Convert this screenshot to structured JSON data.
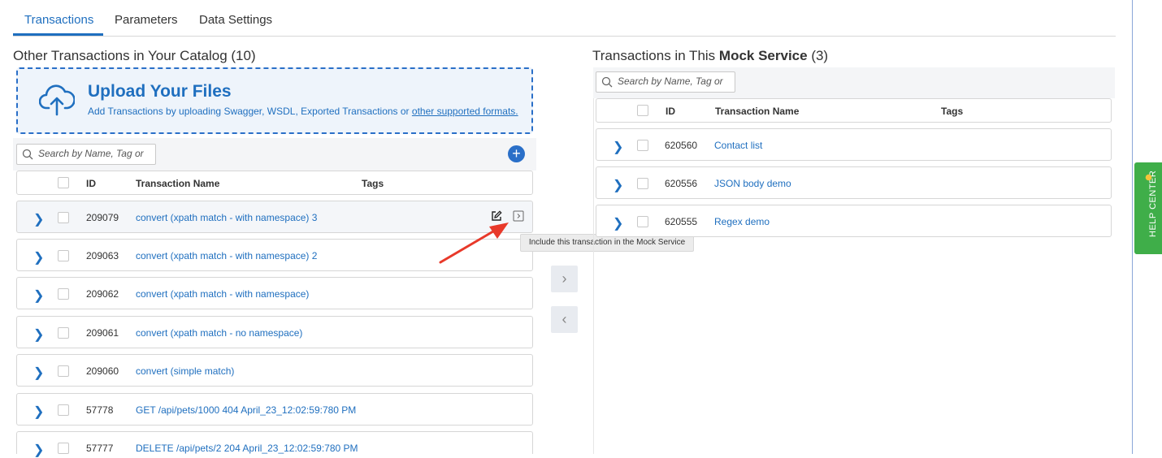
{
  "tabs": [
    {
      "label": "Transactions",
      "active": true
    },
    {
      "label": "Parameters",
      "active": false
    },
    {
      "label": "Data Settings",
      "active": false
    }
  ],
  "left": {
    "title": "Other Transactions in Your Catalog (10)",
    "upload": {
      "title": "Upload Your Files",
      "subtitle": "Add Transactions by uploading Swagger, WSDL, Exported Transactions or ",
      "link": "other supported formats."
    },
    "search_placeholder": "Search by Name, Tag or ID",
    "add_label": "+",
    "columns": {
      "id": "ID",
      "name": "Transaction Name",
      "tags": "Tags"
    },
    "rows": [
      {
        "id": "209079",
        "name": "convert (xpath match - with namespace) 3"
      },
      {
        "id": "209063",
        "name": "convert (xpath match - with namespace) 2"
      },
      {
        "id": "209062",
        "name": "convert (xpath match - with namespace)"
      },
      {
        "id": "209061",
        "name": "convert (xpath match - no namespace)"
      },
      {
        "id": "209060",
        "name": "convert (simple match)"
      },
      {
        "id": "57778",
        "name": "GET /api/pets/1000 404 April_23_12:02:59:780 PM"
      },
      {
        "id": "57777",
        "name": "DELETE /api/pets/2 204 April_23_12:02:59:780 PM"
      }
    ],
    "tooltip": "Include this transaction in the Mock Service"
  },
  "right": {
    "title_prefix": "Transactions in This ",
    "title_bold": "Mock Service",
    "title_suffix": " (3)",
    "search_placeholder": "Search by Name, Tag or ID",
    "columns": {
      "id": "ID",
      "name": "Transaction Name",
      "tags": "Tags"
    },
    "rows": [
      {
        "id": "620560",
        "name": "Contact list"
      },
      {
        "id": "620556",
        "name": "JSON body demo"
      },
      {
        "id": "620555",
        "name": "Regex demo"
      }
    ]
  },
  "move_buttons": {
    "right": "›",
    "left": "‹"
  },
  "help_center": "HELP CENTER",
  "colors": {
    "accent": "#1f6fbf",
    "help": "#3fae49",
    "annotation_arrow": "#e8392a"
  }
}
